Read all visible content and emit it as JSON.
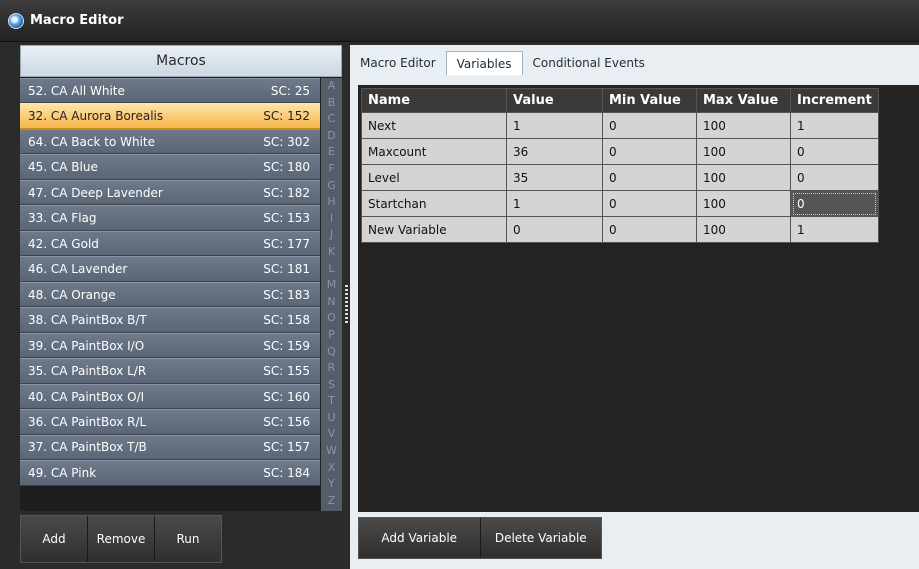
{
  "window": {
    "title": "Macro Editor"
  },
  "macros": {
    "header": "Macros",
    "items": [
      {
        "label": "52. CA All White",
        "sc": "SC: 25"
      },
      {
        "label": "32. CA Aurora Borealis",
        "sc": "SC: 152"
      },
      {
        "label": "64. CA Back to White",
        "sc": "SC: 302"
      },
      {
        "label": "45. CA Blue",
        "sc": "SC: 180"
      },
      {
        "label": "47. CA Deep Lavender",
        "sc": "SC: 182"
      },
      {
        "label": "33. CA Flag",
        "sc": "SC: 153"
      },
      {
        "label": "42. CA Gold",
        "sc": "SC: 177"
      },
      {
        "label": "46. CA Lavender",
        "sc": "SC: 181"
      },
      {
        "label": "48. CA Orange",
        "sc": "SC: 183"
      },
      {
        "label": "38. CA PaintBox B/T",
        "sc": "SC: 158"
      },
      {
        "label": "39. CA PaintBox I/O",
        "sc": "SC: 159"
      },
      {
        "label": "35. CA PaintBox L/R",
        "sc": "SC: 155"
      },
      {
        "label": "40. CA PaintBox O/I",
        "sc": "SC: 160"
      },
      {
        "label": "36. CA PaintBox R/L",
        "sc": "SC: 156"
      },
      {
        "label": "37. CA PaintBox T/B",
        "sc": "SC: 157"
      },
      {
        "label": "49. CA Pink",
        "sc": "SC: 184"
      }
    ],
    "selected_index": 1,
    "alpha_index": [
      "A",
      "B",
      "C",
      "D",
      "E",
      "F",
      "G",
      "H",
      "I",
      "J",
      "K",
      "L",
      "M",
      "N",
      "O",
      "P",
      "Q",
      "R",
      "S",
      "T",
      "U",
      "V",
      "W",
      "X",
      "Y",
      "Z"
    ]
  },
  "left_buttons": {
    "add": "Add",
    "remove": "Remove",
    "run": "Run"
  },
  "tabs": [
    {
      "label": "Macro Editor",
      "active": false
    },
    {
      "label": "Variables",
      "active": true
    },
    {
      "label": "Conditional Events",
      "active": false
    }
  ],
  "variables": {
    "columns": [
      "Name",
      "Value",
      "Min Value",
      "Max Value",
      "Increment"
    ],
    "rows": [
      [
        "Next",
        "1",
        "0",
        "100",
        "1"
      ],
      [
        "Maxcount",
        "36",
        "0",
        "100",
        "0"
      ],
      [
        "Level",
        "35",
        "0",
        "100",
        "0"
      ],
      [
        "Startchan",
        "1",
        "0",
        "100",
        "0"
      ],
      [
        "New Variable",
        "0",
        "0",
        "100",
        "1"
      ]
    ]
  },
  "right_buttons": {
    "add_variable": "Add Variable",
    "delete_variable": "Delete Variable"
  },
  "colors": {
    "selected_row": "#f7b54b",
    "list_row": "#5a6676",
    "grid_bg": "#232323"
  }
}
